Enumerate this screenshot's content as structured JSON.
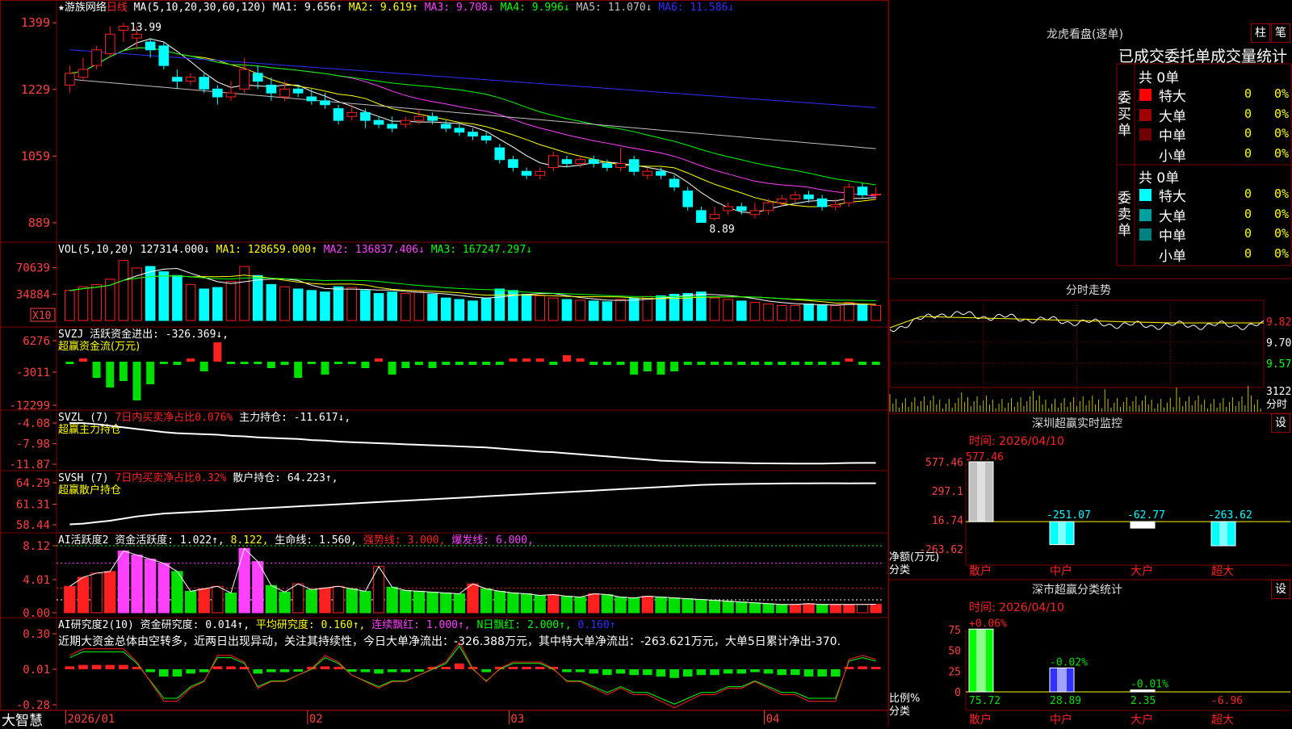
{
  "colors": {
    "up": "#ff2020",
    "down": "#00ffff",
    "inflow": "#ff2020",
    "outflow": "#00e000",
    "grid": "#800000",
    "axis_text": "#ff4040",
    "ma1": "#ffffff",
    "ma2": "#ffff00",
    "ma3": "#ff40ff",
    "ma4": "#00ff00",
    "ma5": "#c0c0c0",
    "ma6": "#3030ff"
  },
  "stock": {
    "name": "游族网络",
    "period": "日线",
    "star": "★"
  },
  "price_header": [
    {
      "text": "MA(5,10,20,30,60,120)",
      "color": "#ffffff"
    },
    {
      "text": "MA1: 9.656↑",
      "color": "#ffffff"
    },
    {
      "text": "MA2: 9.619↑",
      "color": "#ffff00"
    },
    {
      "text": "MA3: 9.708↓",
      "color": "#ff40ff"
    },
    {
      "text": "MA4: 9.996↓",
      "color": "#00ff00"
    },
    {
      "text": "MA5: 11.070↓",
      "color": "#c0c0c0"
    },
    {
      "text": "MA6: 11.586↓",
      "color": "#3030ff"
    }
  ],
  "price_axis": [
    "1399",
    "1229",
    "1059",
    "889"
  ],
  "price_high_label": "13.99",
  "price_low_label": "8.89",
  "vol_header": [
    {
      "text": "VOL(5,10,20)",
      "color": "#ffffff"
    },
    {
      "text": "127314.000↓",
      "color": "#ffffff"
    },
    {
      "text": "MA1: 128659.000↑",
      "color": "#ffff00"
    },
    {
      "text": "MA2: 136837.406↓",
      "color": "#ff40ff"
    },
    {
      "text": "MA3: 167247.297↓",
      "color": "#00ff00"
    }
  ],
  "vol_axis": [
    "70639",
    "34884"
  ],
  "vol_unit": "X10",
  "svzj_header": [
    {
      "text": "SVZJ  活跃资金进出: -326.369↓,",
      "color": "#ffffff"
    }
  ],
  "svzj_sub": "超赢资金流(万元)",
  "svzj_axis": [
    "6276",
    "-3011",
    "-12299"
  ],
  "svzl_header": [
    {
      "text": "SVZL (7)",
      "color": "#ffffff"
    },
    {
      "text": "7日内买卖净占比0.076%",
      "color": "#ff2020"
    },
    {
      "text": "主力持仓: -11.617↓,",
      "color": "#ffffff"
    }
  ],
  "svzl_sub": "超赢主力持仓",
  "svzl_axis": [
    "-4.08",
    "-7.98",
    "-11.87"
  ],
  "svsh_header": [
    {
      "text": "SVSH (7)",
      "color": "#ffffff"
    },
    {
      "text": "7日内买卖净占比0.32%",
      "color": "#ff2020"
    },
    {
      "text": "散户持仓: 64.223↑,",
      "color": "#ffffff"
    }
  ],
  "svsh_sub": "超赢散户持仓",
  "svsh_axis": [
    "64.29",
    "61.31",
    "58.44"
  ],
  "ai1_header": [
    {
      "text": "AI活跃度2",
      "color": "#ffffff"
    },
    {
      "text": "资金活跃度: 1.022↑,",
      "color": "#ffffff"
    },
    {
      "text": "8.122,",
      "color": "#ffff00"
    },
    {
      "text": "生命线: 1.560,",
      "color": "#ffffff"
    },
    {
      "text": "强势线: 3.000,",
      "color": "#ff2020"
    },
    {
      "text": "爆发线: 6.000,",
      "color": "#ff40ff"
    }
  ],
  "ai1_axis": [
    "8.12",
    "4.01",
    "0.00"
  ],
  "ai2_header": [
    {
      "text": "AI研究度2(10)",
      "color": "#ffffff"
    },
    {
      "text": "资金研究度: 0.014↑,",
      "color": "#ffffff"
    },
    {
      "text": "平均研究度: 0.160↑,",
      "color": "#ffff00"
    },
    {
      "text": "连续飘红: 1.000↑,",
      "color": "#ff40ff"
    },
    {
      "text": "N日飘红: 2.000↑,",
      "color": "#00ff00"
    },
    {
      "text": "0.160↑",
      "color": "#3030ff"
    }
  ],
  "ai2_comment": "近期大资金总体由空转多，近两日出现异动，关注其持续性，今日大单净流出：-326.388万元，其中特大单净流出：-263.621万元，大单5日累计净出-370.",
  "ai2_axis": [
    "0.30",
    "0.01",
    "-0.28"
  ],
  "x_axis": [
    "2026/01",
    "02",
    "03",
    "04"
  ],
  "brand": "大智慧",
  "right": {
    "longhu": {
      "title": "龙虎看盘(逐单)",
      "btn1": "柱",
      "btn2": "笔",
      "subtitle": "已成交委托单成交量统计",
      "buy_label": "委买单",
      "sell_label": "委卖单",
      "buy_total": "共 0单",
      "sell_total": "共 0单",
      "buy_rows": [
        {
          "name": "特大",
          "count": "0",
          "pct": "0%",
          "color": "#ff0000"
        },
        {
          "name": "大单",
          "count": "0",
          "pct": "0%",
          "color": "#a00000"
        },
        {
          "name": "中单",
          "count": "0",
          "pct": "0%",
          "color": "#700000"
        },
        {
          "name": "小单",
          "count": "0",
          "pct": "0%",
          "color": ""
        }
      ],
      "sell_rows": [
        {
          "name": "特大",
          "count": "0",
          "pct": "0%",
          "color": "#00ffff"
        },
        {
          "name": "大单",
          "count": "0",
          "pct": "0%",
          "color": "#00a0a0"
        },
        {
          "name": "中单",
          "count": "0",
          "pct": "0%",
          "color": "#008080"
        },
        {
          "name": "小单",
          "count": "0",
          "pct": "0%",
          "color": ""
        }
      ]
    },
    "fenshi": {
      "title": "分时走势",
      "axis": [
        "9.82",
        "9.70",
        "9.57"
      ],
      "vol_axis": "3122",
      "vol_unit": "分时"
    },
    "monitor": {
      "title": "深圳超赢实时监控",
      "btn": "设",
      "time": "时间: 2026/04/10",
      "axis": [
        "577.46",
        "297.1",
        "16.74",
        "-263.62"
      ],
      "ylabel": "净额(万元)",
      "xlabel": "分类",
      "bars": [
        {
          "cat": "散户",
          "value": 577.46,
          "label": "577.46",
          "color": "#c0c0c0"
        },
        {
          "cat": "中户",
          "value": -251.07,
          "label": "-251.07",
          "color": "#00ffff"
        },
        {
          "cat": "大户",
          "value": -62.77,
          "label": "-62.77",
          "color": "#ffffff"
        },
        {
          "cat": "超大",
          "value": -263.62,
          "label": "-263.62",
          "color": "#00ffff"
        }
      ]
    },
    "classify": {
      "title": "深市超赢分类统计",
      "btn": "设",
      "time": "时间: 2026/04/10",
      "axis": [
        "75",
        "50",
        "25",
        "0"
      ],
      "ylabel": "比例%",
      "xlabel": "分类",
      "bars": [
        {
          "cat": "散户",
          "value": 75.72,
          "label": "75.72",
          "delta": "+0.06%",
          "color": "#00ff00"
        },
        {
          "cat": "中户",
          "value": 28.89,
          "label": "28.89",
          "delta": "-0.02%",
          "color": "#3030ff"
        },
        {
          "cat": "大户",
          "value": 2.35,
          "label": "2.35",
          "delta": "-0.01%",
          "color": "#ffffff"
        },
        {
          "cat": "超大",
          "value": -6.96,
          "label": "-6.96",
          "delta": "",
          "color": "#ff2020"
        }
      ]
    }
  },
  "chart_data": {
    "type": "candlestick",
    "price_range": [
      8.89,
      13.99
    ],
    "candles": [
      [
        12.4,
        12.7,
        12.9,
        12.2
      ],
      [
        12.6,
        12.8,
        13.1,
        12.5
      ],
      [
        12.9,
        13.3,
        13.4,
        12.8
      ],
      [
        13.2,
        13.7,
        13.9,
        13.1
      ],
      [
        13.8,
        13.9,
        13.99,
        13.5
      ],
      [
        13.6,
        13.7,
        13.9,
        13.3
      ],
      [
        13.5,
        13.3,
        13.6,
        13.1
      ],
      [
        13.4,
        12.9,
        13.5,
        12.8
      ],
      [
        12.6,
        12.5,
        12.8,
        12.3
      ],
      [
        12.5,
        12.6,
        12.7,
        12.4
      ],
      [
        12.6,
        12.3,
        12.7,
        12.2
      ],
      [
        12.3,
        12.1,
        12.4,
        11.9
      ],
      [
        12.1,
        12.2,
        12.5,
        12.0
      ],
      [
        12.3,
        12.8,
        13.1,
        12.2
      ],
      [
        12.7,
        12.5,
        12.9,
        12.3
      ],
      [
        12.4,
        12.2,
        12.6,
        12.0
      ],
      [
        12.1,
        12.3,
        12.5,
        12.0
      ],
      [
        12.3,
        12.2,
        12.4,
        12.1
      ],
      [
        12.1,
        12.0,
        12.3,
        11.9
      ],
      [
        12.0,
        11.9,
        12.2,
        11.8
      ],
      [
        11.8,
        11.5,
        11.9,
        11.4
      ],
      [
        11.6,
        11.7,
        11.9,
        11.5
      ],
      [
        11.7,
        11.5,
        11.8,
        11.3
      ],
      [
        11.5,
        11.4,
        11.6,
        11.3
      ],
      [
        11.4,
        11.3,
        11.6,
        11.2
      ],
      [
        11.4,
        11.5,
        11.6,
        11.3
      ],
      [
        11.5,
        11.6,
        11.8,
        11.4
      ],
      [
        11.6,
        11.5,
        11.7,
        11.4
      ],
      [
        11.4,
        11.3,
        11.5,
        11.2
      ],
      [
        11.3,
        11.2,
        11.4,
        11.1
      ],
      [
        11.2,
        11.1,
        11.3,
        11.0
      ],
      [
        11.1,
        11.0,
        11.2,
        10.9
      ],
      [
        10.8,
        10.5,
        10.9,
        10.4
      ],
      [
        10.5,
        10.3,
        10.6,
        10.2
      ],
      [
        10.2,
        10.1,
        10.3,
        10.0
      ],
      [
        10.1,
        10.2,
        10.3,
        10.0
      ],
      [
        10.3,
        10.6,
        10.7,
        10.2
      ],
      [
        10.5,
        10.4,
        10.6,
        10.3
      ],
      [
        10.4,
        10.5,
        10.6,
        10.3
      ],
      [
        10.5,
        10.4,
        10.6,
        10.3
      ],
      [
        10.4,
        10.3,
        10.5,
        10.2
      ],
      [
        10.3,
        10.4,
        10.8,
        10.2
      ],
      [
        10.5,
        10.2,
        10.6,
        10.1
      ],
      [
        10.1,
        10.2,
        10.3,
        10.0
      ],
      [
        10.2,
        10.1,
        10.3,
        10.0
      ],
      [
        10.0,
        9.8,
        10.1,
        9.7
      ],
      [
        9.7,
        9.3,
        9.8,
        9.2
      ],
      [
        9.2,
        8.9,
        9.3,
        8.89
      ],
      [
        9.0,
        9.1,
        9.3,
        8.95
      ],
      [
        9.2,
        9.3,
        9.4,
        9.1
      ],
      [
        9.3,
        9.2,
        9.4,
        9.1
      ],
      [
        9.1,
        9.2,
        9.4,
        9.0
      ],
      [
        9.2,
        9.4,
        9.5,
        9.1
      ],
      [
        9.4,
        9.5,
        9.6,
        9.3
      ],
      [
        9.5,
        9.6,
        9.7,
        9.4
      ],
      [
        9.6,
        9.5,
        9.7,
        9.4
      ],
      [
        9.5,
        9.3,
        9.6,
        9.2
      ],
      [
        9.3,
        9.35,
        9.5,
        9.2
      ],
      [
        9.4,
        9.8,
        9.9,
        9.3
      ],
      [
        9.8,
        9.6,
        9.9,
        9.5
      ],
      [
        9.6,
        9.62,
        9.8,
        9.5
      ]
    ],
    "volume": [
      40,
      45,
      48,
      55,
      80,
      70,
      72,
      65,
      60,
      48,
      42,
      44,
      52,
      72,
      60,
      48,
      45,
      42,
      40,
      38,
      45,
      44,
      40,
      36,
      38,
      36,
      38,
      35,
      30,
      28,
      26,
      30,
      42,
      40,
      35,
      33,
      30,
      28,
      27,
      26,
      25,
      28,
      30,
      32,
      33,
      35,
      36,
      38,
      30,
      28,
      26,
      24,
      22,
      20,
      20,
      22,
      21,
      20,
      24,
      22,
      20
    ],
    "svzj": [
      0,
      1,
      -5,
      -8,
      -6,
      -12,
      -7,
      0,
      -1,
      1,
      -3,
      6,
      0,
      0,
      0,
      -2,
      -1,
      -5,
      0,
      -4,
      0,
      0,
      -2,
      1,
      -4,
      -2,
      -1,
      -2,
      -1,
      -1,
      -1,
      -1,
      -1,
      1,
      1,
      1,
      -1,
      2,
      1,
      -1,
      -1,
      -1,
      -4,
      -3,
      -4,
      -3,
      -1,
      -1,
      -1,
      -1,
      -1,
      -1,
      -1,
      -1,
      -1,
      -1,
      -1,
      -1,
      1,
      -1,
      -1
    ],
    "svzl": [
      -4.08,
      -4.1,
      -4.3,
      -4.6,
      -4.9,
      -5.2,
      -5.5,
      -5.8,
      -6.0,
      -6.1,
      -6.2,
      -6.3,
      -6.5,
      -6.6,
      -6.8,
      -6.9,
      -7.0,
      -7.1,
      -7.3,
      -7.4,
      -7.6,
      -7.7,
      -7.8,
      -7.9,
      -8.0,
      -8.1,
      -8.2,
      -8.3,
      -8.4,
      -8.5,
      -8.6,
      -8.7,
      -8.9,
      -9.1,
      -9.3,
      -9.5,
      -9.6,
      -9.8,
      -10.0,
      -10.2,
      -10.4,
      -10.6,
      -10.8,
      -11.0,
      -11.2,
      -11.3,
      -11.4,
      -11.5,
      -11.55,
      -11.6,
      -11.65,
      -11.7,
      -11.72,
      -11.74,
      -11.75,
      -11.76,
      -11.75,
      -11.7,
      -11.65,
      -11.62,
      -11.617
    ],
    "svsh": [
      58.5,
      58.6,
      58.8,
      59.0,
      59.3,
      59.6,
      59.8,
      60.0,
      60.1,
      60.2,
      60.3,
      60.4,
      60.5,
      60.6,
      60.7,
      60.8,
      60.9,
      61.0,
      61.1,
      61.2,
      61.3,
      61.4,
      61.5,
      61.6,
      61.7,
      61.8,
      61.9,
      62.0,
      62.1,
      62.2,
      62.3,
      62.4,
      62.5,
      62.6,
      62.7,
      62.8,
      62.9,
      63.0,
      63.1,
      63.2,
      63.3,
      63.4,
      63.5,
      63.6,
      63.7,
      63.8,
      63.9,
      64.0,
      64.05,
      64.1,
      64.12,
      64.15,
      64.17,
      64.19,
      64.2,
      64.21,
      64.22,
      64.22,
      64.21,
      64.22,
      64.223
    ],
    "ai1": [
      3.2,
      4.3,
      4.8,
      5.0,
      7.5,
      7.0,
      6.5,
      6.0,
      5.0,
      2.6,
      2.9,
      3.2,
      2.4,
      7.8,
      6.2,
      3.3,
      2.5,
      3.5,
      2.8,
      3.0,
      3.2,
      2.9,
      2.6,
      5.6,
      3.1,
      2.7,
      2.6,
      2.5,
      2.4,
      2.3,
      3.5,
      2.9,
      2.6,
      2.4,
      2.3,
      2.1,
      2.2,
      2.0,
      1.9,
      2.3,
      2.2,
      1.9,
      1.8,
      2.0,
      1.9,
      1.8,
      1.7,
      1.6,
      1.5,
      1.4,
      1.3,
      1.2,
      1.1,
      1.0,
      1.0,
      1.1,
      1.0,
      1.0,
      1.0,
      1.0,
      1.022
    ],
    "ai2": [
      0.02,
      0.03,
      0.03,
      0.03,
      0.03,
      0.01,
      -0.02,
      -0.05,
      -0.05,
      -0.03,
      -0.02,
      0.02,
      0.02,
      0.01,
      -0.03,
      -0.02,
      -0.02,
      -0.01,
      0.0,
      0.02,
      0.01,
      -0.01,
      -0.02,
      -0.03,
      -0.02,
      -0.02,
      -0.01,
      0.0,
      0.01,
      0.04,
      0.0,
      -0.02,
      0.0,
      0.01,
      0.01,
      0.01,
      0.0,
      -0.02,
      -0.02,
      -0.03,
      -0.04,
      -0.03,
      -0.04,
      -0.04,
      -0.05,
      -0.06,
      -0.05,
      -0.04,
      -0.04,
      -0.03,
      -0.03,
      -0.02,
      -0.03,
      -0.04,
      -0.04,
      -0.05,
      -0.05,
      -0.05,
      0.014,
      0.02,
      0.014
    ]
  }
}
